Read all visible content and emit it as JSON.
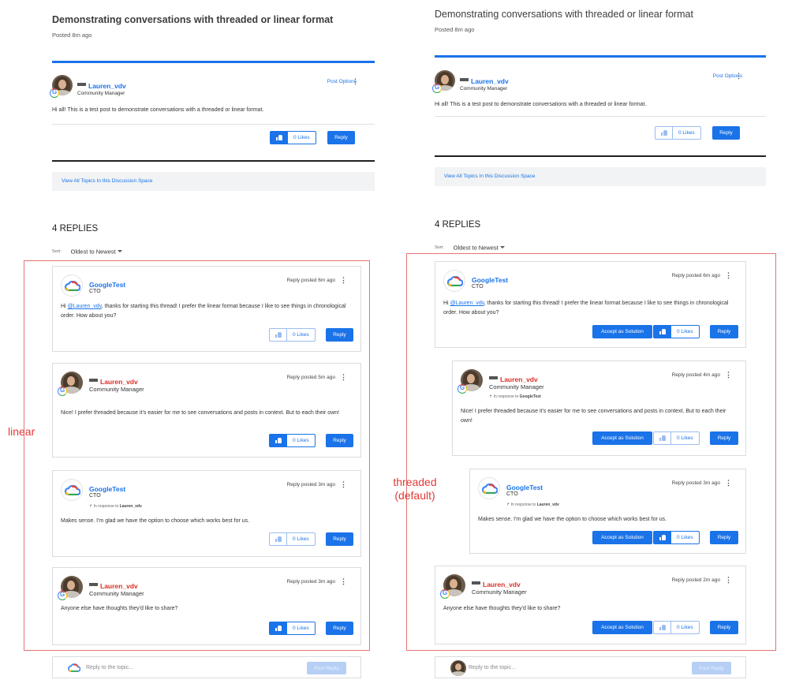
{
  "post": {
    "title": "Demonstrating conversations with threaded or linear format",
    "posted": "Posted 8m ago",
    "author": "Lauren_vdv",
    "author_role": "Community Manager",
    "options_label": "Post Options",
    "body": "Hi all! This is a test post to demonstrate conversations with a threaded or linear format.",
    "likes_label": "0 Likes",
    "reply_label": "Reply",
    "view_all_label": "View All Topics In this Discussion Space"
  },
  "replies_header": {
    "count_label": "4 REPLIES",
    "sort_label": "Sort:",
    "sort_value": "Oldest to Newest"
  },
  "replies": [
    {
      "author": "GoogleTest",
      "role": "CTO",
      "in_response_to": "",
      "time_left": "Reply posted 6m ago",
      "time_right": "Reply posted 6m ago",
      "body_pre": "Hi ",
      "mention": "@Lauren_vdv",
      "body_post": ", thanks for starting this thread! I prefer the linear format because I like to see things in chronological order. How about you?"
    },
    {
      "author": "Lauren_vdv",
      "role": "Community Manager",
      "in_response_to": "GoogleTest",
      "time_left": "Reply posted 5m ago",
      "time_right": "Reply posted 4m ago",
      "body": "Nice! I prefer threaded because it's easier for me to see conversations and posts in context. But to each their own!"
    },
    {
      "author": "GoogleTest",
      "role": "CTO",
      "in_response_to": "Lauren_vdv",
      "time_left": "Reply posted 3m ago",
      "time_right": "Reply posted 3m ago",
      "body": "Makes sense. I'm glad we have the option to choose which works best for us."
    },
    {
      "author": "Lauren_vdv",
      "role": "Community Manager",
      "in_response_to": "",
      "time_left": "Reply posted 3m ago",
      "time_right": "Reply posted 2m ago",
      "body": "Anyone else have thoughts they'd like to share?"
    }
  ],
  "in_response_prefix": "In response to",
  "accept_label": "Accept as Solution",
  "likes_label": "0 Likes",
  "reply_label": "Reply",
  "composer": {
    "placeholder": "Reply to the topic...",
    "post_label": "Post Reply"
  },
  "annotations": {
    "linear": "linear",
    "threaded_1": "threaded",
    "threaded_2": "(default)"
  },
  "colors": {
    "accent": "#1a73e8",
    "annotation": "#e53935",
    "staff_name": "#d93025"
  },
  "icons": [
    "thumbs-up-icon",
    "kebab-menu-icon",
    "caret-down-icon",
    "google-badge-icon",
    "google-cloud-logo-icon",
    "reply-arrow-icon"
  ]
}
